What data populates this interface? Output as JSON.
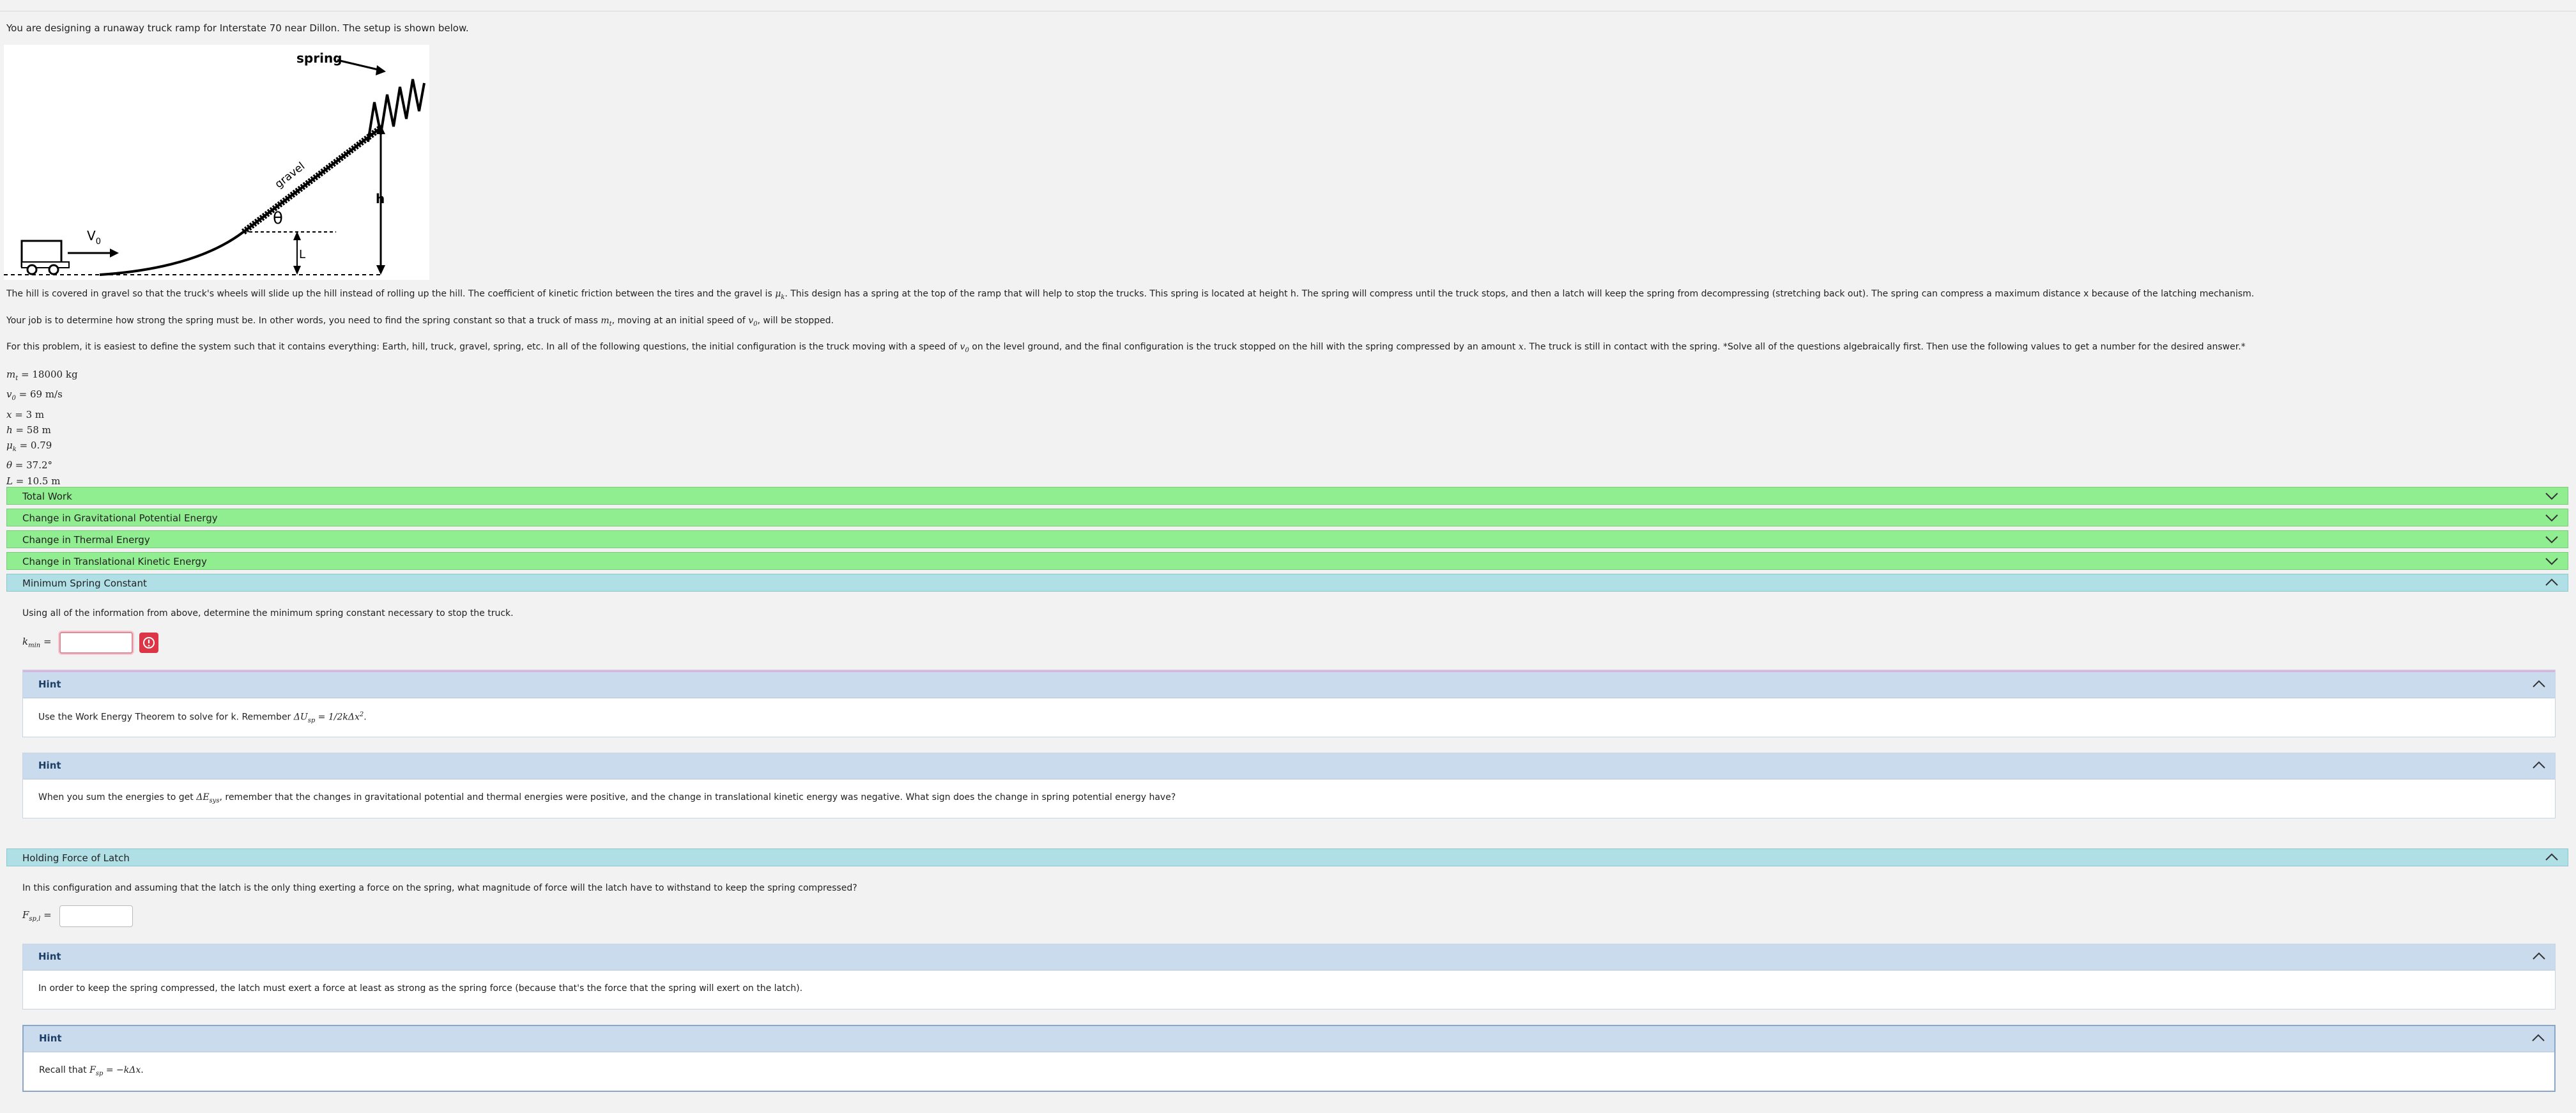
{
  "intro": "You are designing a runaway truck ramp for Interstate 70 near Dillon. The setup is shown below.",
  "figure": {
    "spring_label": "spring",
    "gravel_label": "gravel",
    "theta_label": "θ",
    "h_label": "h",
    "L_label": "L",
    "v0_label": "V",
    "v0_sub": "0"
  },
  "paragraphs": {
    "p1_a": "The hill is covered in gravel so that the truck's wheels will slide up the hill instead of rolling up the hill. The coefficient of kinetic friction between the tires and the gravel is ",
    "p1_mu": "μ",
    "p1_mu_sub": "k",
    "p1_b": ". This design has a spring at the top of the ramp that will help to stop the trucks. This spring is located at height h. The spring will compress until the truck stops, and then a latch will keep the spring from decompressing (stretching back out). The spring can compress a maximum distance x because of the latching mechanism.",
    "p2_a": "Your job is to determine how strong the spring must be. In other words, you need to find the spring constant so that a truck of mass ",
    "p2_m": "m",
    "p2_m_sub": "t",
    "p2_b": ", moving at an initial speed of ",
    "p2_v": "v",
    "p2_v_sub": "0",
    "p2_c": ", will be stopped.",
    "p3_a": "For this problem, it is easiest to define the system such that it contains everything: Earth, hill, truck, gravel, spring, etc. In all of the following questions, the initial configuration is the truck moving with a speed of ",
    "p3_v": "v",
    "p3_v_sub": "0",
    "p3_b": " on the level ground, and the final configuration is the truck stopped on the hill with the spring compressed by an amount ",
    "p3_x": "x",
    "p3_c": ". The truck is still in contact with the spring. *Solve all of the questions algebraically first. Then use the following values to get a number for the desired answer.*"
  },
  "givens": [
    {
      "sym": "m",
      "sub": "t",
      "val": " = 18000 kg"
    },
    {
      "sym": "v",
      "sub": "0",
      "val": " = 69 m/s"
    },
    {
      "sym": "x",
      "sub": "",
      "val": " = 3 m"
    },
    {
      "sym": "h",
      "sub": "",
      "val": " = 58 m"
    },
    {
      "sym": "μ",
      "sub": "k",
      "val": " = 0.79"
    },
    {
      "sym": "θ",
      "sub": "",
      "val": " = 37.2°"
    },
    {
      "sym": "L",
      "sub": "",
      "val": " = 10.5 m"
    }
  ],
  "sections": {
    "total_work": "Total Work",
    "grav_pe": "Change in Gravitational Potential Energy",
    "thermal": "Change in Thermal Energy",
    "kinetic": "Change in Translational Kinetic Energy",
    "min_spring": "Minimum Spring Constant",
    "latch": "Holding Force of Latch"
  },
  "min_spring": {
    "question": "Using all of the information from above, determine the minimum spring constant necessary to stop the truck.",
    "input_label": "k",
    "input_label_sub": "min",
    "input_eq": " =",
    "input_value": "",
    "hint1_title": "Hint",
    "hint1_text": "Use the Work Energy Theorem to solve for k. Remember ",
    "hint1_math": "ΔU",
    "hint1_math_sub": "sp",
    "hint1_math_rest": " = 1/2kΔx",
    "hint1_math_sup": "2",
    "hint1_end": ".",
    "hint2_title": "Hint",
    "hint2_text_a": "When you sum the energies to get ",
    "hint2_math": "ΔE",
    "hint2_math_sub": "sys",
    "hint2_text_b": ", remember that the changes in gravitational potential and thermal energies were positive, and the change in translational kinetic energy was negative. What sign does the change in spring potential energy have?"
  },
  "latch": {
    "question": "In this configuration and assuming that the latch is the only thing exerting a force on the spring, what magnitude of force will the latch have to withstand to keep the spring compressed?",
    "input_label": "F",
    "input_label_sub": "sp,l",
    "input_eq": " =",
    "input_value": "",
    "hint1_title": "Hint",
    "hint1_text": "In order to keep the spring compressed, the latch must exert a force at least as strong as the spring force (because that's the force that the spring will exert on the latch).",
    "hint2_title": "Hint",
    "hint2_text": "Recall that ",
    "hint2_math": "F",
    "hint2_math_sub": "sp",
    "hint2_math_rest": " = −kΔx",
    "hint2_end": "."
  },
  "colors": {
    "completed_section": "#90ee90",
    "open_section": "#b0e0e6",
    "hint_header": "#cbdbee",
    "error_button": "#dc3545"
  },
  "icons": {
    "collapsed": "chevron-down-icon",
    "expanded": "chevron-up-icon",
    "error": "alert-circle-icon"
  }
}
